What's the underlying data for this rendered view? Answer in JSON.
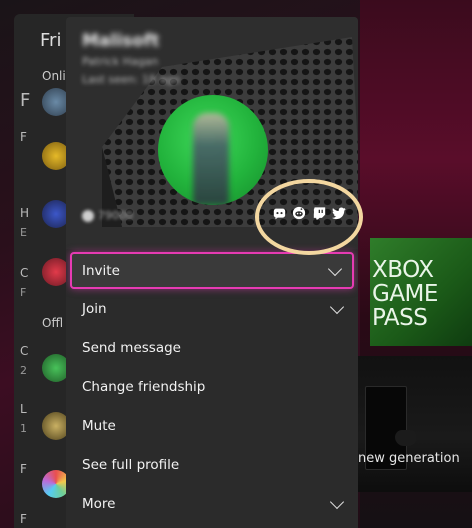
{
  "friends_panel": {
    "title": "Fri",
    "sections": {
      "online": "Onli",
      "offline": "Offl"
    },
    "row_letters": [
      "F",
      "F",
      "H",
      "E",
      "C",
      "F",
      "C",
      "2",
      "L",
      "1",
      "F",
      "F"
    ]
  },
  "profile": {
    "gamertag": "Malisoft",
    "real_name": "Patrick Hagan",
    "last_seen": "Last seen: 18 ago",
    "gamerscore": "79000",
    "social_icons": [
      "discord-icon",
      "reddit-icon",
      "twitch-icon",
      "twitter-icon"
    ]
  },
  "menu": [
    {
      "label": "Invite",
      "has_chevron": true
    },
    {
      "label": "Join",
      "has_chevron": true
    },
    {
      "label": "Send message",
      "has_chevron": false
    },
    {
      "label": "Change friendship",
      "has_chevron": false
    },
    {
      "label": "Mute",
      "has_chevron": false
    },
    {
      "label": "See full profile",
      "has_chevron": false
    },
    {
      "label": "More",
      "has_chevron": true
    }
  ],
  "background": {
    "game_pass_lines": [
      "XBOX",
      "GAME",
      "PASS"
    ],
    "new_generation": "new generation"
  },
  "colors": {
    "focus_border": "#e63bb3",
    "annotation_ring": "#f3d7a0",
    "avatar_green": "#22b33c",
    "game_pass_green": "#2f7d2a"
  }
}
